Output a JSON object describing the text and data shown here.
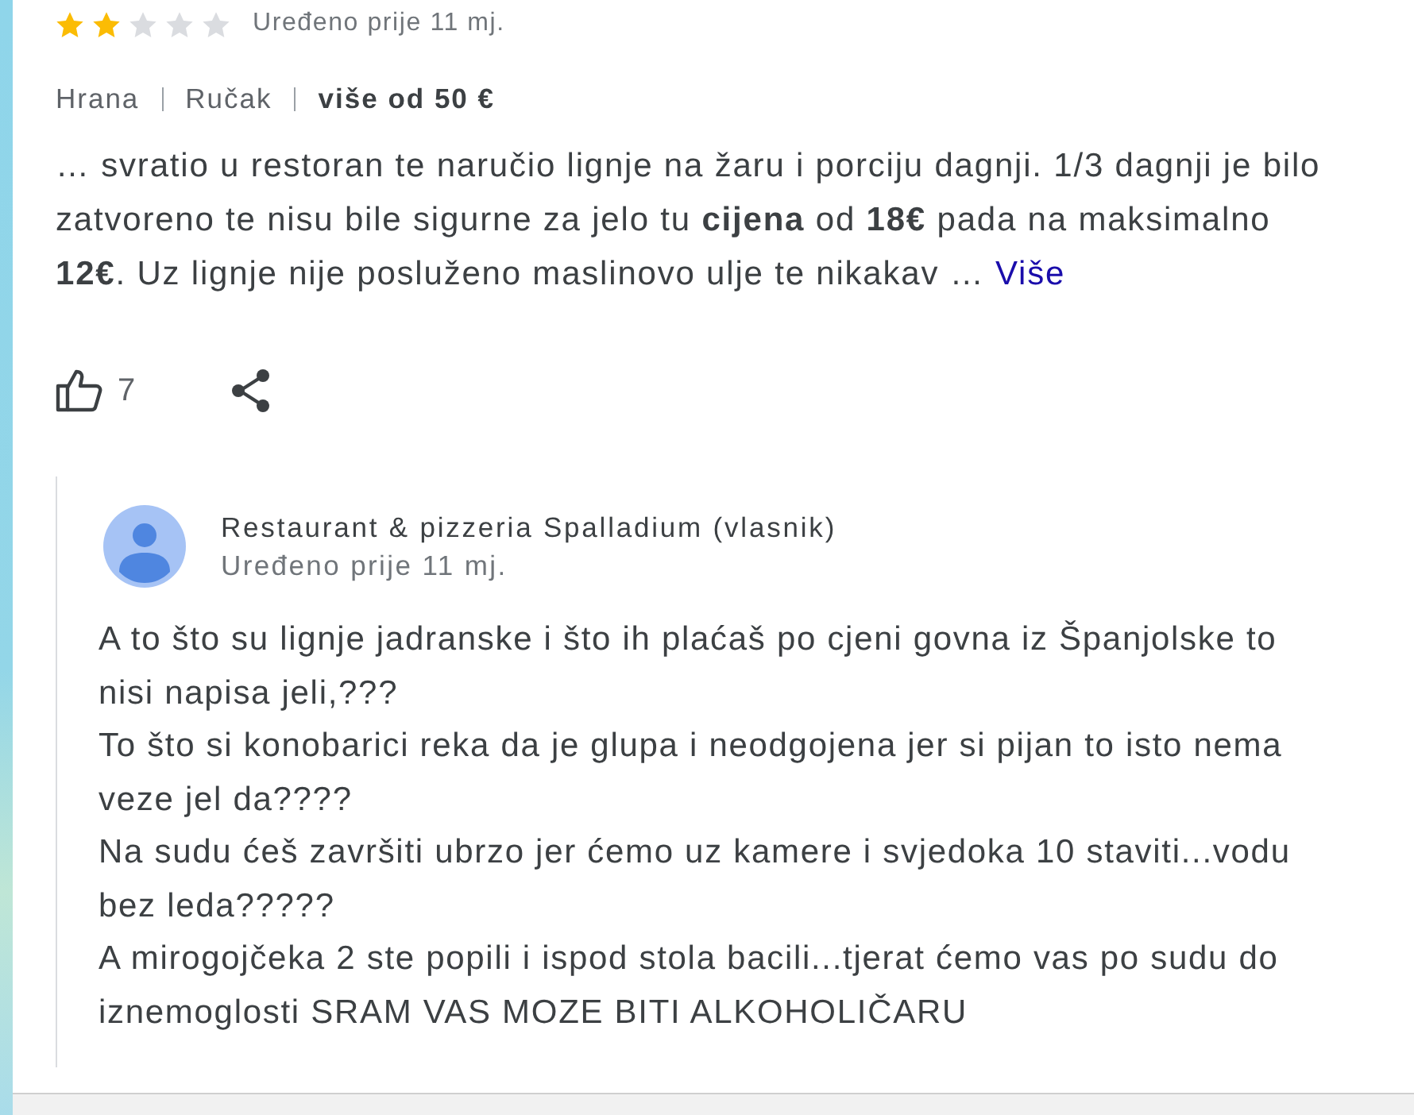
{
  "review": {
    "stars": 2,
    "date": "Uređeno prije 11 mj.",
    "tags": [
      {
        "text": "Hrana",
        "bold": false
      },
      {
        "text": "Ručak",
        "bold": false
      },
      {
        "text": "više od 50 €",
        "bold": true
      }
    ],
    "text": "… svratio u restoran te naručio lignje na žaru i porciju dagnji. 1/3 dagnji je bilo zatvoreno te nisu bile sigurne za jelo tu **cijena** od **18€** pada na maksimalno **12€**. Uz lignje nije posluženo maslinovo ulje te nikakav …",
    "more_link": "Više",
    "likes": "7"
  },
  "owner_reply": {
    "name": "Restaurant & pizzeria Spalladium (vlasnik)",
    "date": "Uređeno prije 11 mj.",
    "paragraphs": [
      "A to što su lignje jadranske i što ih plaćaš po cjeni govna iz Španjolske to nisi napisa jeli,???",
      "To što si konobarici reka da je glupa i neodgojena jer si pijan to isto nema veze jel da????",
      "Na sudu ćeš završiti ubrzo jer ćemo uz kamere i svjedoka 10 staviti...vodu bez leda?????",
      "A mirogojčeka 2 ste popili i ispod stola bacili...tjerat ćemo vas po sudu do iznemoglosti SRAM VAS MOZE BITI ALKOHOLIČARU"
    ]
  }
}
